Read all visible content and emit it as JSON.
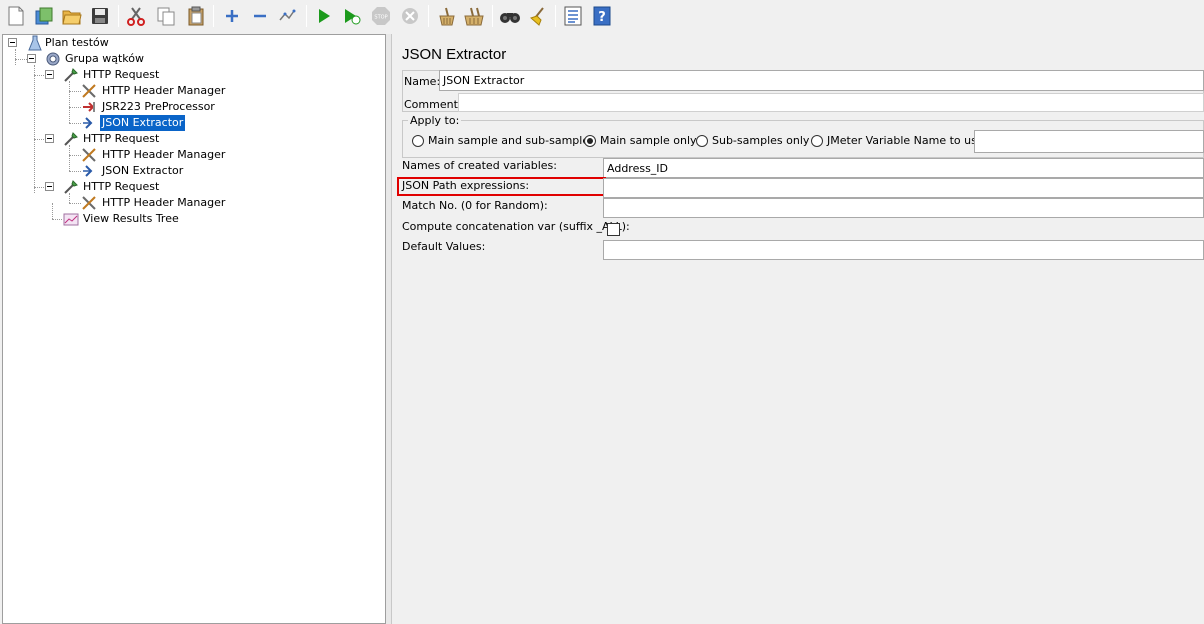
{
  "toolbar": {
    "buttons": [
      "new-icon",
      "templates-icon",
      "open-icon",
      "save-icon",
      "cut-icon",
      "copy-icon",
      "paste-icon",
      "expand-icon",
      "collapse-icon",
      "toggle-icon",
      "start-icon",
      "start-no-pauses-icon",
      "stop-icon",
      "shutdown-icon",
      "clear-icon",
      "clear-all-icon",
      "search-icon",
      "reset-search-icon",
      "function-helper-icon",
      "help-icon"
    ]
  },
  "tree": {
    "nodes": [
      {
        "label": "Plan testów"
      },
      {
        "label": "Grupa wątków"
      },
      {
        "label": "HTTP Request"
      },
      {
        "label": "HTTP Header Manager"
      },
      {
        "label": "JSR223 PreProcessor"
      },
      {
        "label": "JSON Extractor"
      },
      {
        "label": "HTTP Request"
      },
      {
        "label": "HTTP Header Manager"
      },
      {
        "label": "JSON Extractor"
      },
      {
        "label": "HTTP Request"
      },
      {
        "label": "HTTP Header Manager"
      },
      {
        "label": "View Results Tree"
      }
    ],
    "selected_index": 5
  },
  "panel": {
    "title": "JSON Extractor",
    "name_label": "Name:",
    "name_value": "JSON Extractor",
    "comments_label": "Comments:",
    "comments_value": "",
    "apply_to_label": "Apply to:",
    "apply_options": [
      "Main sample and sub-samples",
      "Main sample only",
      "Sub-samples only",
      "JMeter Variable Name to use"
    ],
    "apply_selected": 1,
    "jmeter_var_value": "",
    "names_label": "Names of created variables:",
    "names_value": "Address_ID",
    "json_path_label": "JSON Path expressions:",
    "json_path_value": "",
    "match_no_label": "Match No. (0 for Random):",
    "match_no_value": "",
    "concat_label": "Compute concatenation var (suffix _ALL):",
    "concat_checked": false,
    "default_label": "Default Values:",
    "default_value": ""
  },
  "colors": {
    "selection": "#0a64c8",
    "highlight": "#e00000",
    "run_green": "#1c9a1c"
  }
}
